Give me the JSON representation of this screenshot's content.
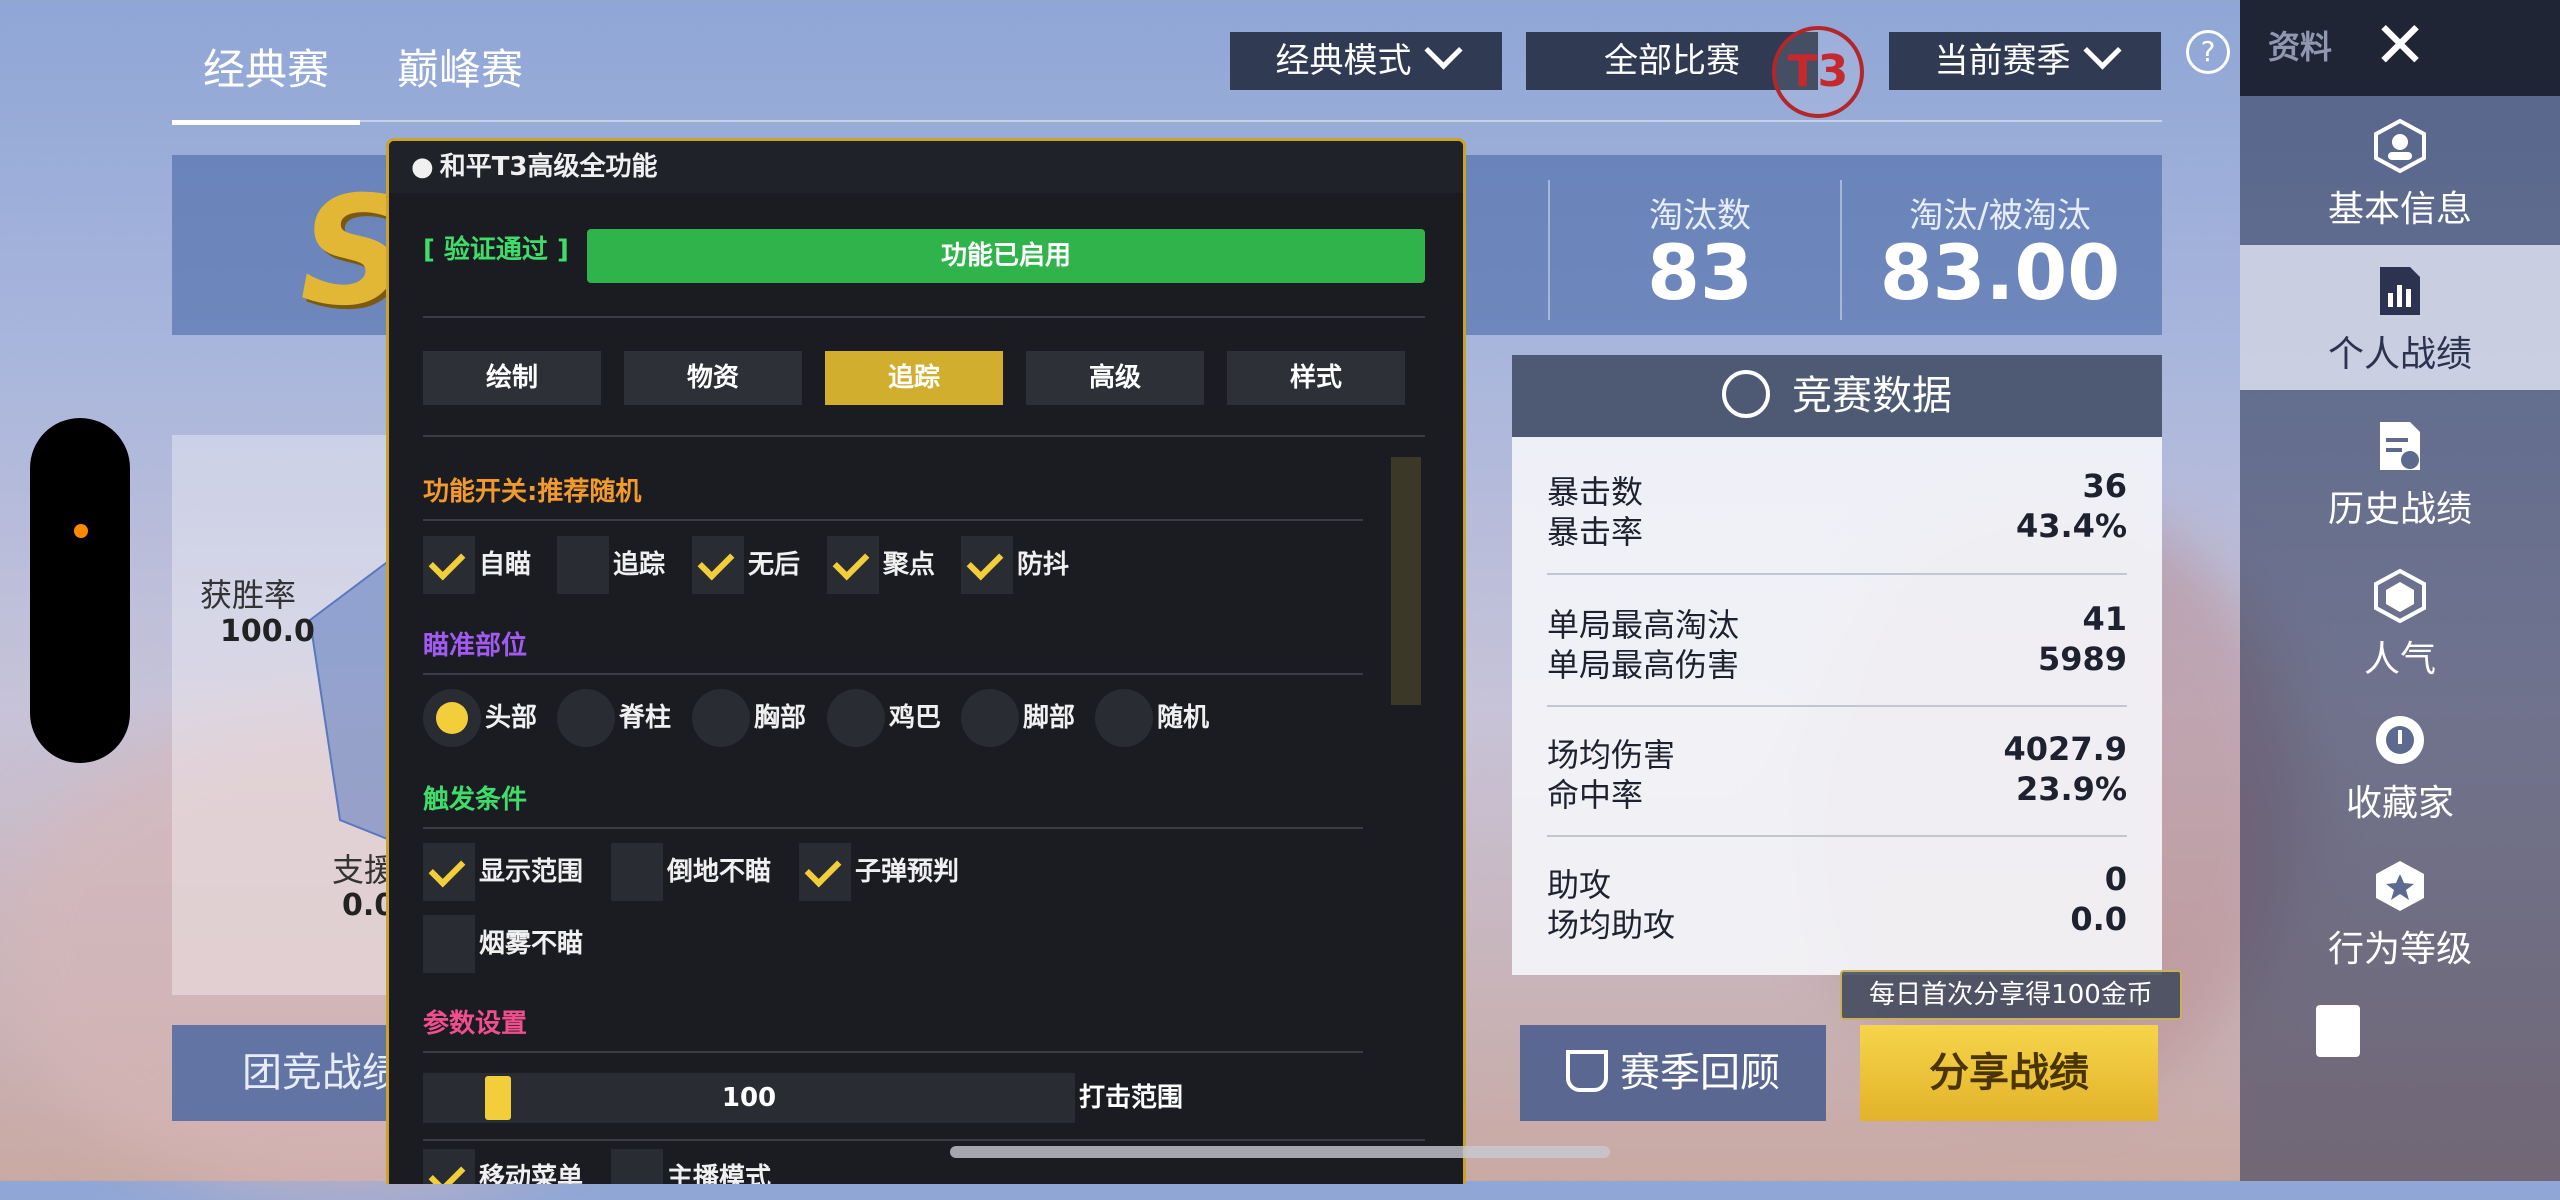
{
  "top_tabs": [
    {
      "label": "经典赛",
      "active": true
    },
    {
      "label": "巅峰赛",
      "active": false
    }
  ],
  "dropdowns": {
    "mode": "经典模式",
    "match": "全部比赛",
    "season": "当前赛季"
  },
  "header_stats": {
    "eliminations_label": "淘汰数",
    "eliminations_value": "83",
    "ratio_label": "淘汰/被淘汰",
    "ratio_value": "83.00"
  },
  "sidebar": {
    "title": "资料",
    "items": [
      {
        "label": "基本信息",
        "icon": "profile-icon"
      },
      {
        "label": "个人战绩",
        "icon": "stats-doc-icon",
        "active": true
      },
      {
        "label": "历史战绩",
        "icon": "history-doc-icon"
      },
      {
        "label": "人气",
        "icon": "popularity-icon"
      },
      {
        "label": "收藏家",
        "icon": "collector-icon"
      },
      {
        "label": "行为等级",
        "icon": "behavior-icon"
      }
    ]
  },
  "left_stats": {
    "win_rate_label": "获胜率",
    "win_rate_value": "100.0",
    "support_label": "支援",
    "support_value": "0.0"
  },
  "competition": {
    "title": "竞赛数据",
    "rows": [
      {
        "label": "暴击数",
        "value": "36"
      },
      {
        "label": "暴击率",
        "value": "43.4%"
      },
      {
        "label": "单局最高淘汰",
        "value": "41"
      },
      {
        "label": "单局最高伤害",
        "value": "5989"
      },
      {
        "label": "场均伤害",
        "value": "4027.9"
      },
      {
        "label": "命中率",
        "value": "23.9%"
      },
      {
        "label": "助攻",
        "value": "0"
      },
      {
        "label": "场均助攻",
        "value": "0.0"
      }
    ]
  },
  "bottom": {
    "team_label": "团竞战绩",
    "season_review": "赛季回顾",
    "share_hint": "每日首次分享得100金币",
    "share_label": "分享战绩"
  },
  "overlay": {
    "title": "和平T3高级全功能",
    "status": "[ 验证通过 ]",
    "enabled": "功能已启用",
    "badge": "T3",
    "tabs": [
      "绘制",
      "物资",
      "追踪",
      "高级",
      "样式"
    ],
    "active_tab": 2,
    "sec_func": "功能开关:推荐随机",
    "func_items": [
      {
        "label": "自瞄",
        "on": true
      },
      {
        "label": "追踪",
        "on": false
      },
      {
        "label": "无后",
        "on": true
      },
      {
        "label": "聚点",
        "on": true
      },
      {
        "label": "防抖",
        "on": true
      }
    ],
    "sec_aim": "瞄准部位",
    "aim_items": [
      {
        "label": "头部",
        "on": true
      },
      {
        "label": "脊柱",
        "on": false
      },
      {
        "label": "胸部",
        "on": false
      },
      {
        "label": "鸡巴",
        "on": false
      },
      {
        "label": "脚部",
        "on": false
      },
      {
        "label": "随机",
        "on": false
      }
    ],
    "sec_trigger": "触发条件",
    "trigger_items": [
      {
        "label": "显示范围",
        "on": true
      },
      {
        "label": "倒地不瞄",
        "on": false
      },
      {
        "label": "子弹预判",
        "on": true
      },
      {
        "label": "烟雾不瞄",
        "on": false
      }
    ],
    "sec_params": "参数设置",
    "slider_value": "100",
    "slider_fraction": 0.11,
    "slider_label": "打击范围",
    "bottom_items": [
      {
        "label": "移动菜单",
        "on": true
      },
      {
        "label": "主播模式",
        "on": false
      }
    ]
  },
  "colors": {
    "accent_gold": "#d1ae2d",
    "enabled_green": "#2fb34a",
    "sec_orange": "#f29a2e",
    "sec_purple": "#a25bf0",
    "sec_green": "#3fdc6a",
    "sec_pink": "#ef4f8c"
  }
}
